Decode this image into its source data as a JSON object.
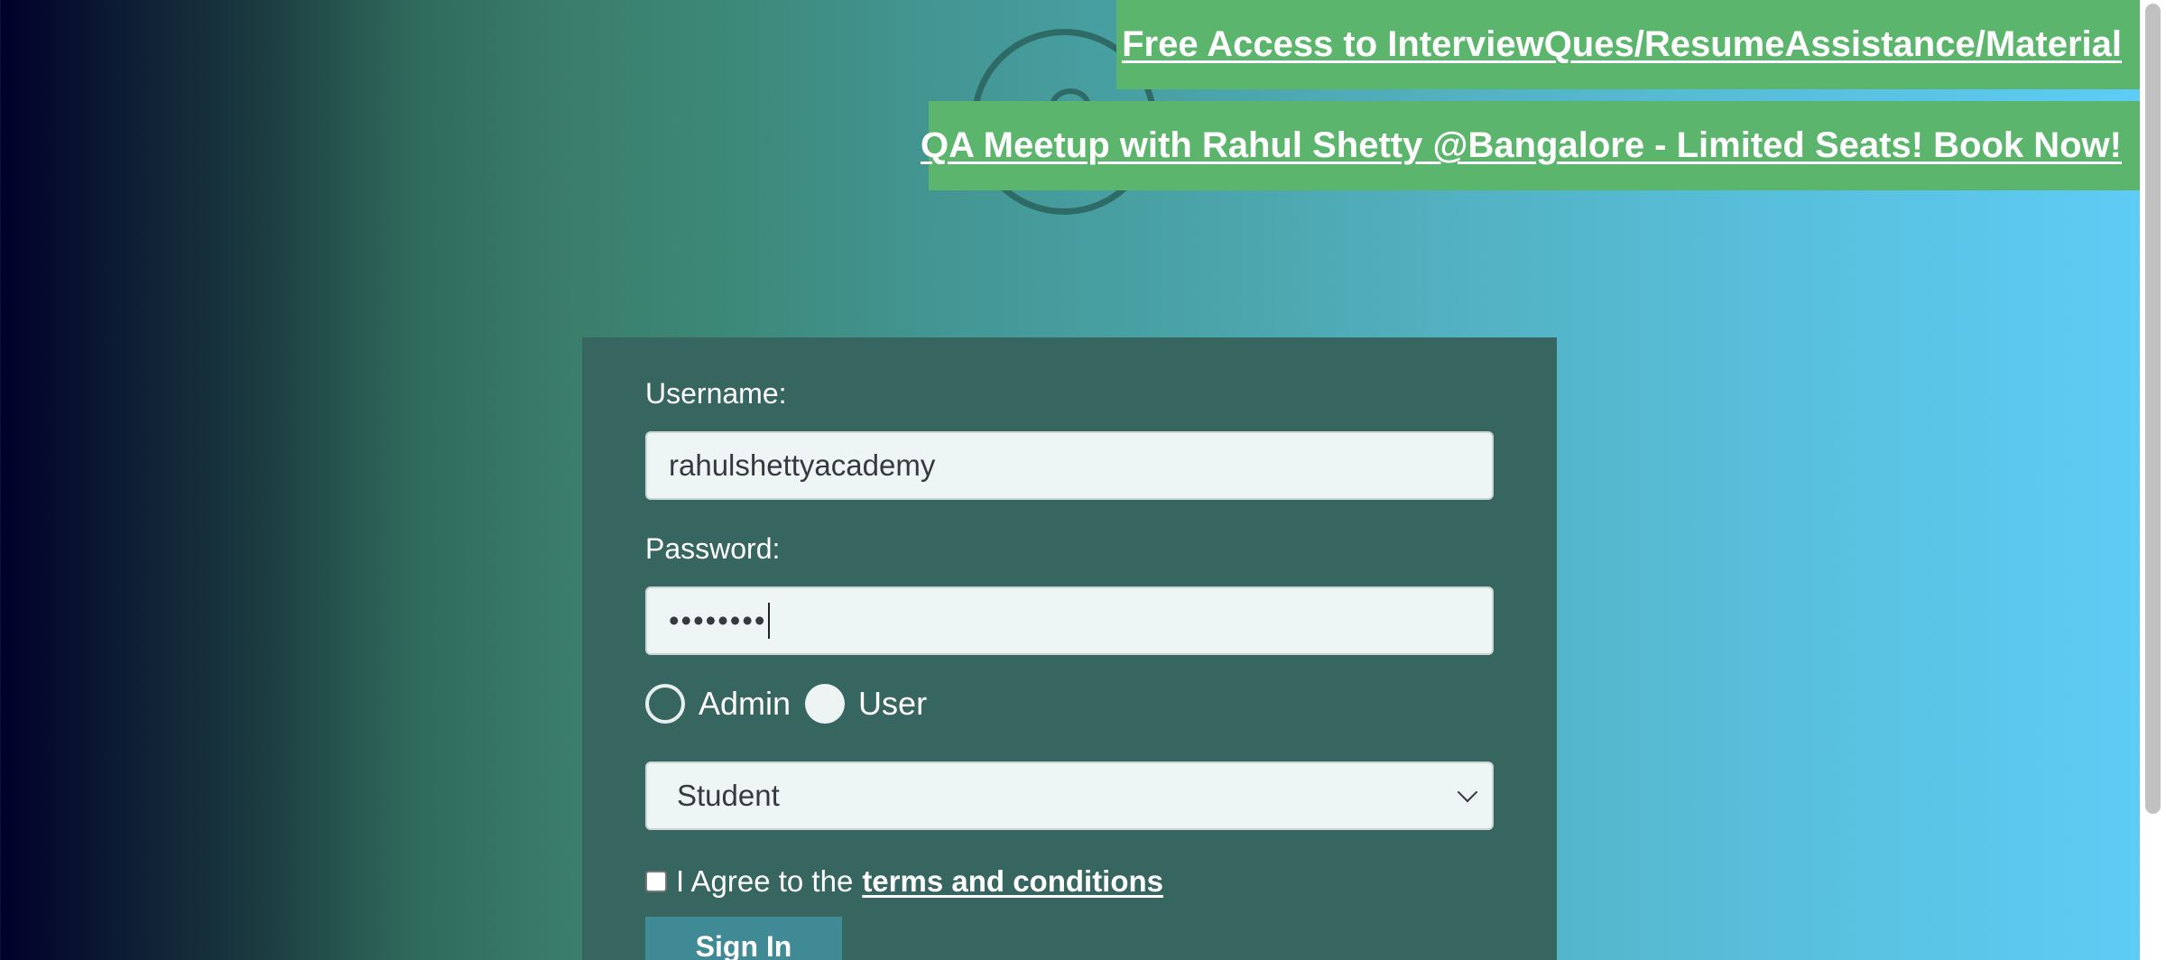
{
  "banners": {
    "free_access": "Free Access to InterviewQues/ResumeAssistance/Material",
    "meetup": "QA Meetup with Rahul Shetty @Bangalore - Limited Seats! Book Now!"
  },
  "form": {
    "username_label": "Username:",
    "username_value": "rahulshettyacademy",
    "password_label": "Password:",
    "password_masked": "••••••••",
    "radio_options": [
      {
        "label": "Admin",
        "selected": true
      },
      {
        "label": "User",
        "selected": false
      }
    ],
    "role_select_value": "Student",
    "terms_prefix": "I Agree to the",
    "terms_link": "terms and conditions",
    "terms_checked": false,
    "signin_label": "Sign In"
  },
  "colors": {
    "banner_bg": "#5cb56c",
    "card_bg": "#36665f",
    "button_bg": "#408a96"
  }
}
